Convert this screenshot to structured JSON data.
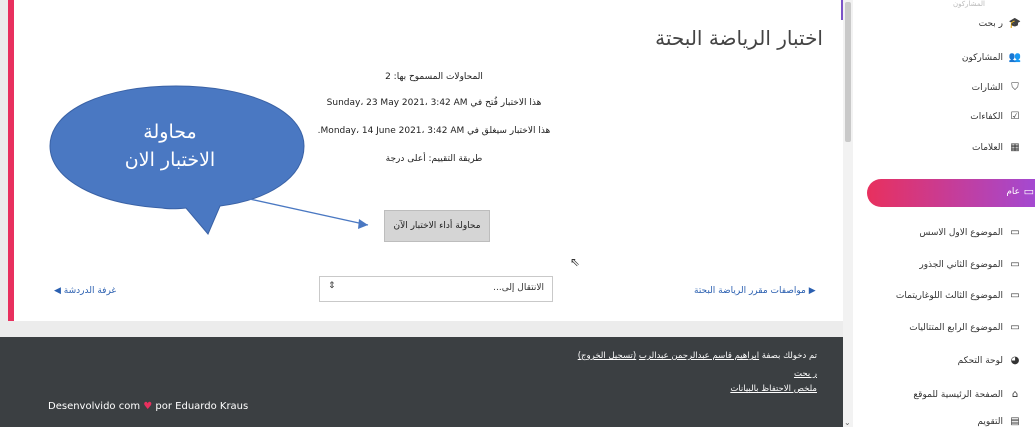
{
  "quiz": {
    "title": "اختبار الرياضة البحتة",
    "attempts_allowed": "المحاولات المسموح بها: 2",
    "opened": "هذا الاختبار فُتح في Sunday، 23 May 2021، 3:42 AM",
    "closes": "هذا الاختبار سيغلق في Monday، 14 June 2021، 3:42 AM.",
    "grading_method": "طريقة التقييم: أعلى درجة",
    "attempt_button": "محاولة أداء الاختبار الآن"
  },
  "navigation": {
    "prev_link": "غرفة الدردشة ◀",
    "next_link": "▶ مواصفات مقرر الرياضة البحتة",
    "jump_placeholder": "الانتقال إلى...",
    "jump_arrows": "⇕"
  },
  "callout": {
    "line1": "محاولة",
    "line2": "الاختبار الان"
  },
  "footer": {
    "logged_in_prefix": "تم دخولك بصفة",
    "logged_in_user": "ابراهيم قاسم عبدالرحمن عبدالرب",
    "logout": "(تسجيل الخروج)",
    "user_line": "ر بحت",
    "data_retention": "ملخص الاحتفاظ بالبيانات",
    "developed_prefix": "Desenvolvido com",
    "developed_heart": "♥",
    "developed_suffix": "por Eduardo Kraus"
  },
  "sidebar": {
    "top_faded": "المشاركون",
    "items": [
      {
        "label": "ر بحت",
        "icon": "graduation-cap-icon",
        "glyph": "🎓"
      },
      {
        "label": "المشاركون",
        "icon": "users-icon",
        "glyph": "👥"
      },
      {
        "label": "الشارات",
        "icon": "shield-icon",
        "glyph": "⛉"
      },
      {
        "label": "الكفاءات",
        "icon": "checkbox-icon",
        "glyph": "☑"
      },
      {
        "label": "العلامات",
        "icon": "table-icon",
        "glyph": "▦"
      },
      {
        "label": "عام",
        "icon": "folder-icon",
        "glyph": "▭"
      },
      {
        "label": "الموضوع الاول الاسس",
        "icon": "folder-icon",
        "glyph": "▭"
      },
      {
        "label": "الموضوع الثاني الجذور",
        "icon": "folder-icon",
        "glyph": "▭"
      },
      {
        "label": "الموضوع الثالث اللوغاريتمات",
        "icon": "folder-icon",
        "glyph": "▭"
      },
      {
        "label": "الموضوع الرابع المتتاليات",
        "icon": "folder-icon",
        "glyph": "▭"
      },
      {
        "label": "لوحة التحكم",
        "icon": "dashboard-icon",
        "glyph": "◕"
      },
      {
        "label": "الصفحة الرئيسية للموقع",
        "icon": "home-icon",
        "glyph": "⌂"
      },
      {
        "label": "التقويم",
        "icon": "calendar-icon",
        "glyph": "▤"
      }
    ]
  },
  "colors": {
    "accent_pink": "#e8305e",
    "accent_purple": "#a14ad6",
    "callout_blue": "#4a78c2",
    "footer_bg": "#3b3f42"
  }
}
